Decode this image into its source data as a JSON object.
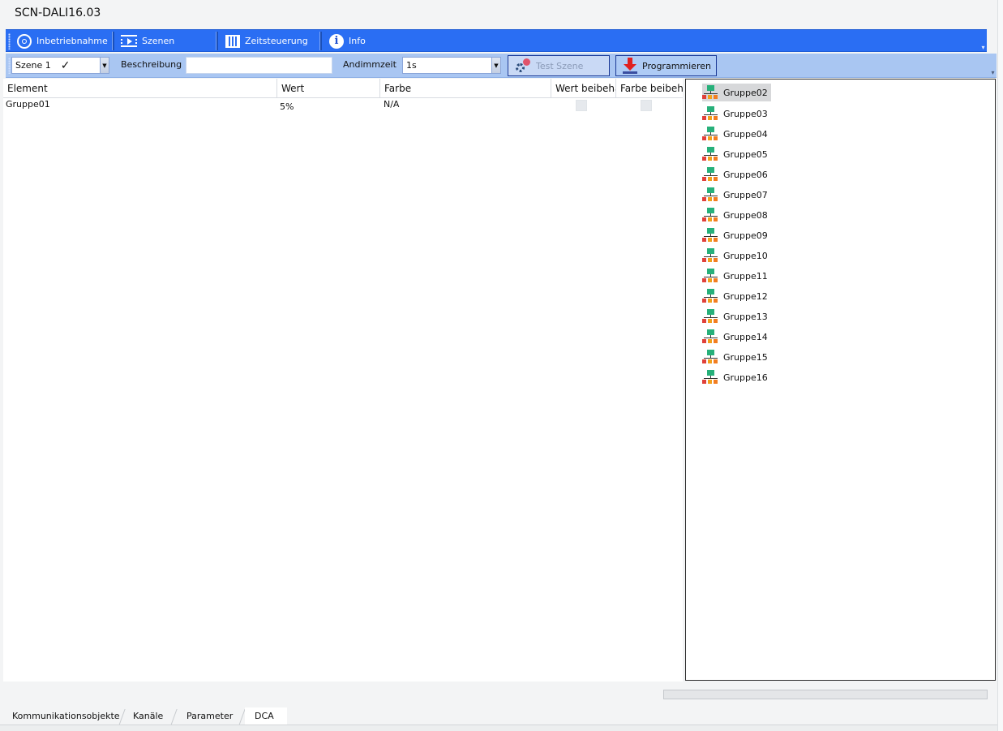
{
  "window": {
    "title": "SCN-DALI16.03"
  },
  "main_toolbar": {
    "items": [
      {
        "label": "Inbetriebnahme",
        "icon": "commissioning-icon"
      },
      {
        "label": "Szenen",
        "icon": "scene-film-icon"
      },
      {
        "label": "Zeitsteuerung",
        "icon": "calendar-icon"
      },
      {
        "label": "Info",
        "icon": "info-icon"
      }
    ]
  },
  "scene_toolbar": {
    "scene_select": "Szene 1",
    "scene_check": "✓",
    "description_label": "Beschreibung",
    "description_value": "",
    "dim_time_label": "Andimmzeit",
    "dim_time_value": "1s",
    "test_button": "Test Szene",
    "program_button": "Programmieren"
  },
  "grid": {
    "columns": [
      "Element",
      "Wert",
      "Farbe",
      "Wert beibeha",
      "Farbe beibeha"
    ],
    "rows": [
      {
        "element": "Gruppe01",
        "wert": "5%",
        "farbe": "N/A",
        "wert_beibehalten": false,
        "farbe_beibehalten": false
      }
    ]
  },
  "group_list": {
    "selected": "Gruppe02",
    "items": [
      "Gruppe02",
      "Gruppe03",
      "Gruppe04",
      "Gruppe05",
      "Gruppe06",
      "Gruppe07",
      "Gruppe08",
      "Gruppe09",
      "Gruppe10",
      "Gruppe11",
      "Gruppe12",
      "Gruppe13",
      "Gruppe14",
      "Gruppe15",
      "Gruppe16"
    ]
  },
  "bottom_tabs": {
    "active": "DCA",
    "items": [
      "Kommunikationsobjekte",
      "Kanäle",
      "Parameter",
      "DCA"
    ]
  },
  "colors": {
    "toolbar_blue": "#2a6ef3",
    "subtoolbar_blue": "#a9c6f2",
    "group_icon_green": "#27b07a",
    "program_arrow_red": "#e02020"
  }
}
